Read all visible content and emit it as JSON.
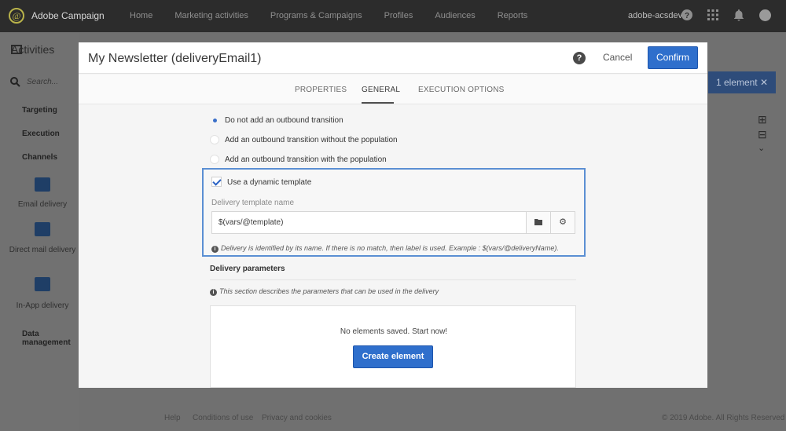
{
  "app": {
    "title": "Adobe Campaign",
    "logo_glyph": "@"
  },
  "topnav": [
    "Home",
    "Marketing activities",
    "Programs & Campaigns",
    "Profiles",
    "Audiences",
    "Reports"
  ],
  "account": {
    "name": "adobe-acsdev"
  },
  "icons": {
    "help": "help-icon",
    "apps": "apps-grid-icon",
    "notifications": "bell-icon",
    "user": "avatar"
  },
  "left_panel": {
    "title": "Activities",
    "search_placeholder": "Search...",
    "categories": [
      "Targeting",
      "Execution",
      "Channels",
      "Data management"
    ],
    "channels": [
      "Email delivery",
      "Direct mail delivery",
      "In-App delivery"
    ]
  },
  "right": {
    "selection_badge": "1 element"
  },
  "footer": {
    "links": [
      "Help",
      "Conditions of use",
      "Privacy and cookies"
    ],
    "copyright": "© 2019 Adobe. All Rights Reserved"
  },
  "modal": {
    "title": "My Newsletter (deliveryEmail1)",
    "help_glyph": "?",
    "cancel_label": "Cancel",
    "confirm_label": "Confirm",
    "tabs": [
      {
        "label": "PROPERTIES",
        "active": false
      },
      {
        "label": "GENERAL",
        "active": true
      },
      {
        "label": "EXECUTION OPTIONS",
        "active": false
      }
    ],
    "transition_options": [
      {
        "label": "Do not add an outbound transition",
        "selected": true
      },
      {
        "label": "Add an outbound transition without the population",
        "selected": false
      },
      {
        "label": "Add an outbound transition with the population",
        "selected": false
      }
    ],
    "dynamic_template": {
      "checked": true,
      "label": "Use a dynamic template",
      "field_label": "Delivery template name",
      "field_value": "$(vars/@template)",
      "hint": "Delivery is identified by its name. If there is no match, then label is used. Example : $(vars/@deliveryName)."
    },
    "delivery_parameters": {
      "title": "Delivery parameters",
      "hint": "This section describes the parameters that can be used in the delivery",
      "empty_text": "No elements saved. Start now!",
      "create_label": "Create element"
    }
  },
  "colors": {
    "accent": "#2f6fcc",
    "highlight_border": "#5b8fd3",
    "topbar": "#2c2c2c"
  }
}
